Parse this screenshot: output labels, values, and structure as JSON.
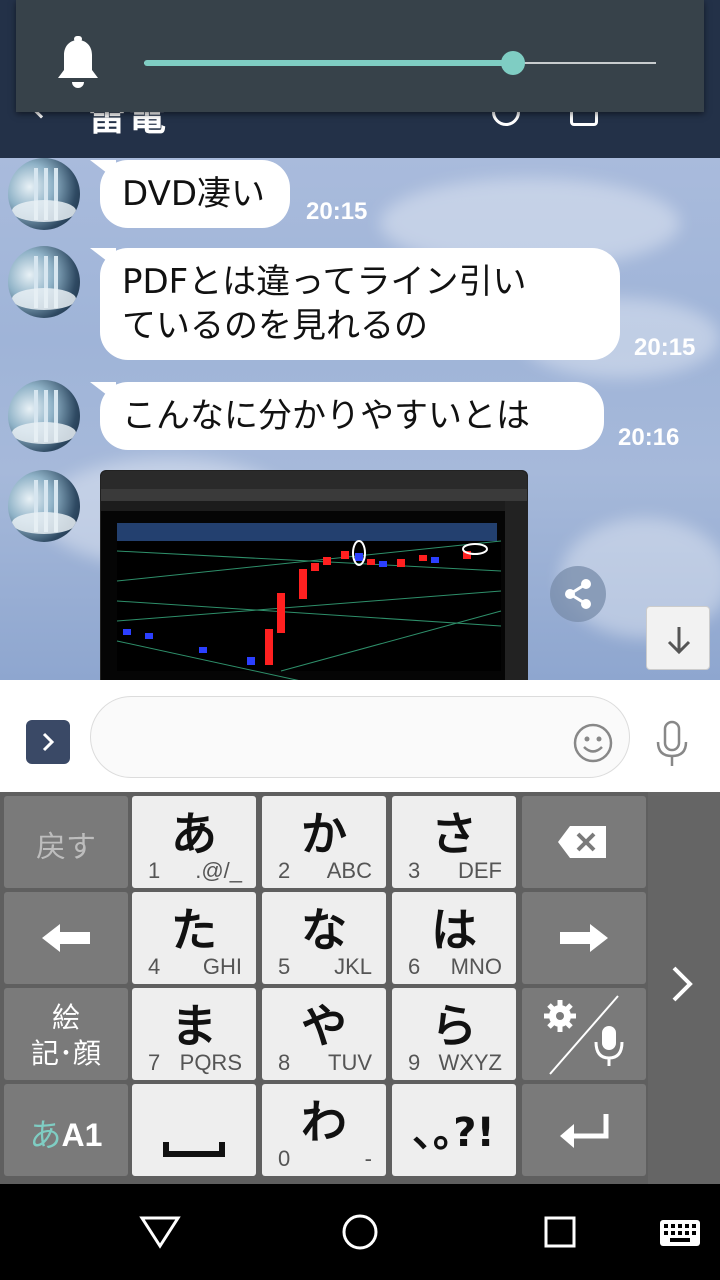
{
  "header": {
    "title": "雷電"
  },
  "volume": {
    "level_percent": 72
  },
  "messages": [
    {
      "text": "DVD凄い",
      "time": "20:15"
    },
    {
      "text_line1": "PDFとは違ってライン引い",
      "text_line2": "ているのを見れるの",
      "time": "20:15"
    },
    {
      "text": "こんなに分かりやすいとは",
      "time": "20:16"
    }
  ],
  "input": {
    "placeholder": ""
  },
  "keyboard": {
    "back_label": "戻す",
    "emoji_label_1": "絵",
    "emoji_label_2": "記･顔",
    "mode_label_kana": "あ",
    "mode_label_alpha": "A1",
    "punct_label": "､｡?!",
    "keys": [
      {
        "main": "あ",
        "num": "1",
        "sub": ".@/_"
      },
      {
        "main": "か",
        "num": "2",
        "sub": "ABC"
      },
      {
        "main": "さ",
        "num": "3",
        "sub": "DEF"
      },
      {
        "main": "た",
        "num": "4",
        "sub": "GHI"
      },
      {
        "main": "な",
        "num": "5",
        "sub": "JKL"
      },
      {
        "main": "は",
        "num": "6",
        "sub": "MNO"
      },
      {
        "main": "ま",
        "num": "7",
        "sub": "PQRS"
      },
      {
        "main": "や",
        "num": "8",
        "sub": "TUV"
      },
      {
        "main": "ら",
        "num": "9",
        "sub": "WXYZ"
      },
      {
        "main": "わ",
        "num": "0",
        "sub": "-"
      }
    ]
  },
  "colors": {
    "accent": "#7fcdc3",
    "header": "#233148",
    "keyboard_bg": "#5f5f5f"
  }
}
